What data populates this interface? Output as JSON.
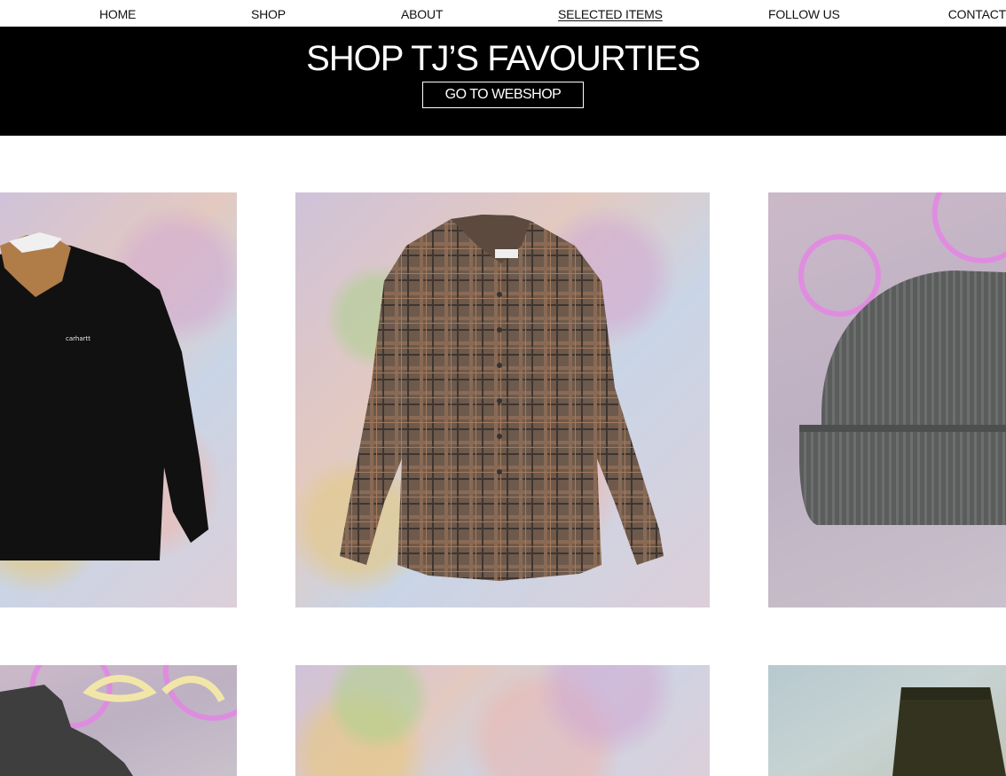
{
  "nav": {
    "home": "HOME",
    "shop": "SHOP",
    "about": "ABOUT",
    "selected_items": "SELECTED ITEMS",
    "follow_us": "FOLLOW US",
    "contact": "CONTACT"
  },
  "banner": {
    "title": "SHOP TJ’S FAVOURTIES",
    "button": "GO TO WEBSHOP"
  },
  "products": [
    {
      "item": "black rugby shirt",
      "brand_logo": "carhartt"
    },
    {
      "item": "brown plaid shirt"
    },
    {
      "item": "grey knit beanie"
    },
    {
      "item": "grey turtleneck sweater"
    },
    {
      "item": "graffiti tile"
    },
    {
      "item": "olive trousers"
    }
  ]
}
